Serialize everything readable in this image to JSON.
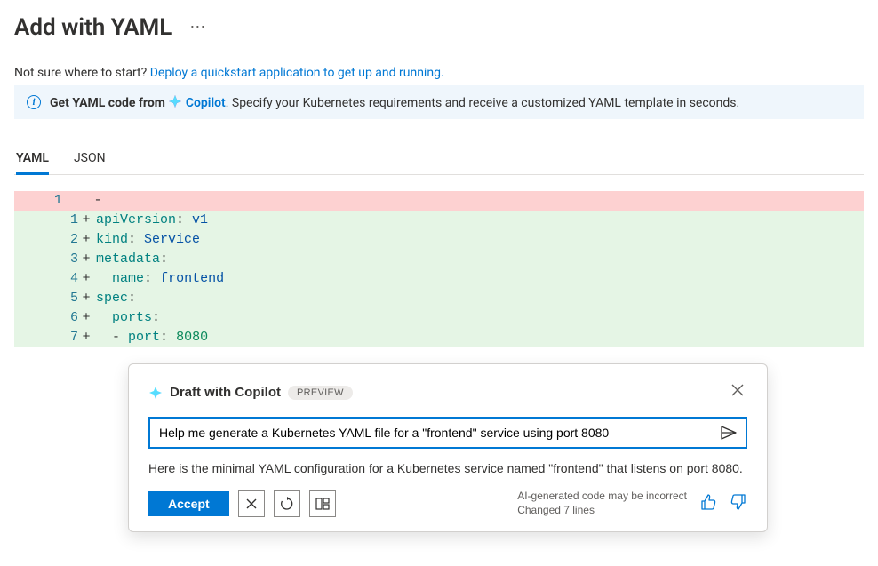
{
  "header": {
    "title": "Add with YAML"
  },
  "help": {
    "prefix": "Not sure where to start? ",
    "link_text": "Deploy a quickstart application to get up and running."
  },
  "banner": {
    "lead": "Get YAML code from",
    "copilot_label": "Copilot",
    "tail": ". Specify your Kubernetes requirements and receive a customized YAML template in seconds."
  },
  "tabs": [
    {
      "label": "YAML",
      "active": true
    },
    {
      "label": "JSON",
      "active": false
    }
  ],
  "editor": {
    "removed_line_no": "1",
    "removed_glyph": "-",
    "added_lines": [
      {
        "n": "1",
        "key": "apiVersion",
        "val": "v1",
        "indent": ""
      },
      {
        "n": "2",
        "key": "kind",
        "val": "Service",
        "indent": ""
      },
      {
        "n": "3",
        "key": "metadata",
        "colon_only": true,
        "indent": ""
      },
      {
        "n": "4",
        "key": "name",
        "val": "frontend",
        "indent": "  "
      },
      {
        "n": "5",
        "key": "spec",
        "colon_only": true,
        "indent": ""
      },
      {
        "n": "6",
        "key": "ports",
        "colon_only": true,
        "indent": "  "
      },
      {
        "n": "7",
        "dash": true,
        "key": "port",
        "val": "8080",
        "num": true,
        "indent": "  "
      }
    ]
  },
  "panel": {
    "title": "Draft with Copilot",
    "badge": "PREVIEW",
    "prompt": "Help me generate a Kubernetes YAML file for a \"frontend\" service using port 8080",
    "reply": "Here is the minimal YAML configuration for a Kubernetes service named \"frontend\" that listens on port 8080.",
    "accept_label": "Accept",
    "meta_line1": "AI-generated code may be incorrect",
    "meta_line2": "Changed 7 lines"
  }
}
